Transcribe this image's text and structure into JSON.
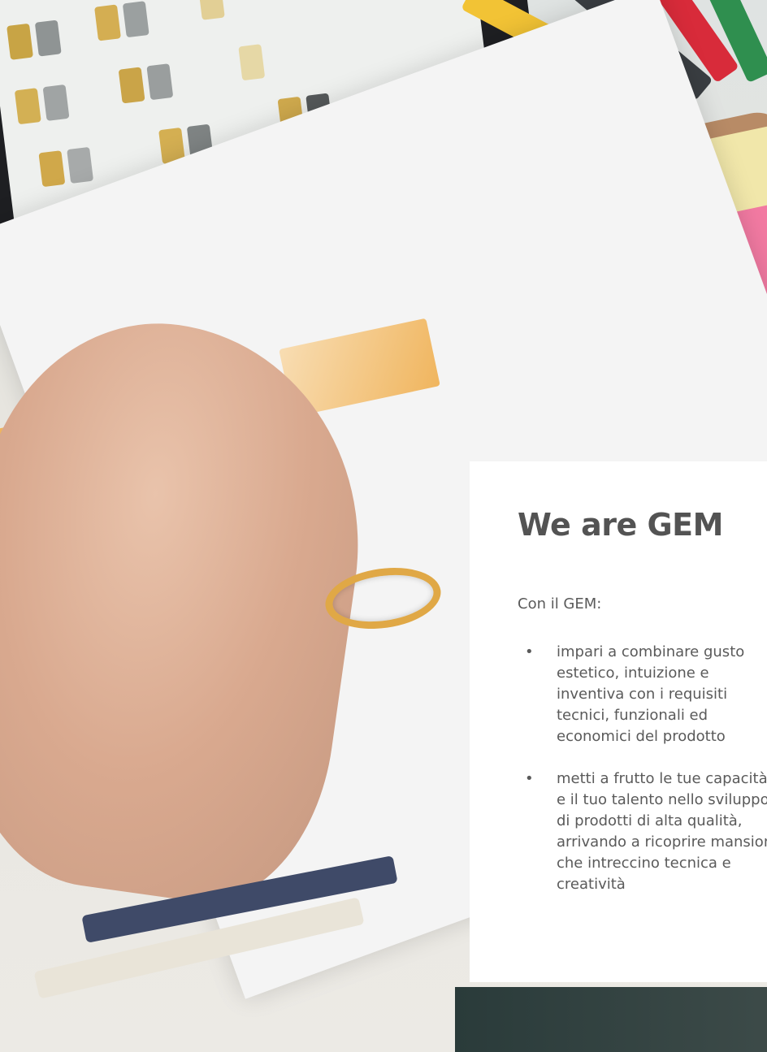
{
  "card": {
    "title": "We are GEM",
    "intro": "Con il GEM:",
    "bullet_glyph": "•",
    "bullets": [
      {
        "text": "impari a combinare gusto estetico, intuizione e inventiva con i requisiti tecnici, funzionali ed economici del prodotto"
      },
      {
        "text": "metti a frutto le tue capacità e il tuo talento nello sviluppo di prodotti di alta qualità, arrivando a ricoprire mansioni che intreccino tecnica e creatività"
      }
    ]
  },
  "colors": {
    "card_background": "#ffffff",
    "title_text": "#535353",
    "body_text": "#5a5a5a"
  }
}
